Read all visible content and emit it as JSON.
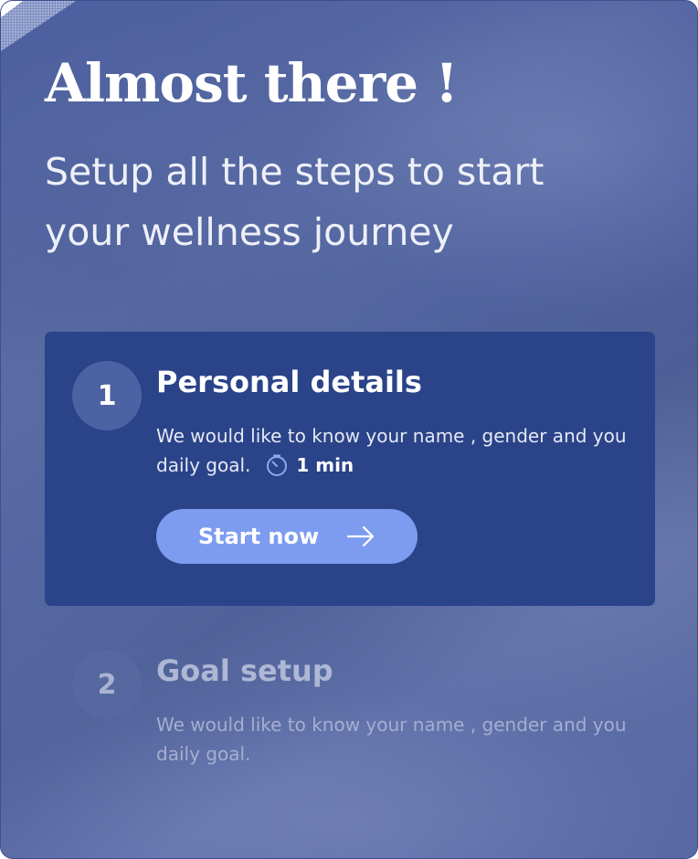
{
  "header": {
    "title": "Almost there !",
    "subtitle": "Setup all the steps to start your wellness journey"
  },
  "steps": [
    {
      "number": "1",
      "title": "Personal details",
      "description": "We would like to know your name , gender and you daily goal.",
      "duration": "1 min",
      "duration_icon": "timer-icon",
      "button_label": "Start now",
      "button_icon": "arrow-right-icon",
      "state": "active"
    },
    {
      "number": "2",
      "title": "Goal setup",
      "description": "We would like to know your name , gender and you daily goal.",
      "state": "inactive"
    }
  ],
  "colors": {
    "background": "#4f62a0",
    "active_card": "#2a4389",
    "button": "#7d9cf0",
    "inactive_text": "#a4aed0"
  }
}
